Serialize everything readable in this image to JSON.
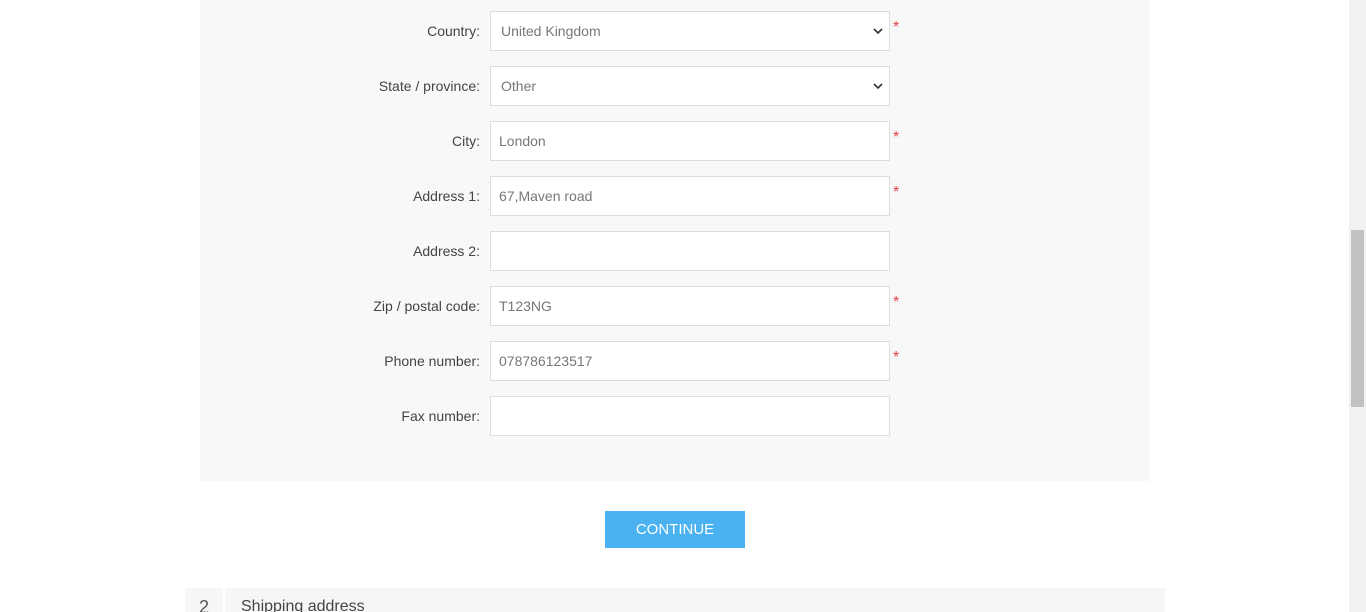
{
  "form": {
    "country": {
      "label": "Country:",
      "value": "United Kingdom",
      "required_mark": "*"
    },
    "state": {
      "label": "State / province:",
      "value": "Other"
    },
    "city": {
      "label": "City:",
      "value": "London",
      "required_mark": "*"
    },
    "address1": {
      "label": "Address 1:",
      "value": "67,Maven road",
      "required_mark": "*"
    },
    "address2": {
      "label": "Address 2:",
      "value": ""
    },
    "zip": {
      "label": "Zip / postal code:",
      "value": "T123NG",
      "required_mark": "*"
    },
    "phone": {
      "label": "Phone number:",
      "value": "078786123517",
      "required_mark": "*"
    },
    "fax": {
      "label": "Fax number:",
      "value": ""
    }
  },
  "continue_label": "CONTINUE",
  "next_step": {
    "number": "2",
    "title": "Shipping address"
  },
  "colors": {
    "accent": "#4ab2f1",
    "required": "#e4434b",
    "panel_bg": "#f8f8f8"
  }
}
